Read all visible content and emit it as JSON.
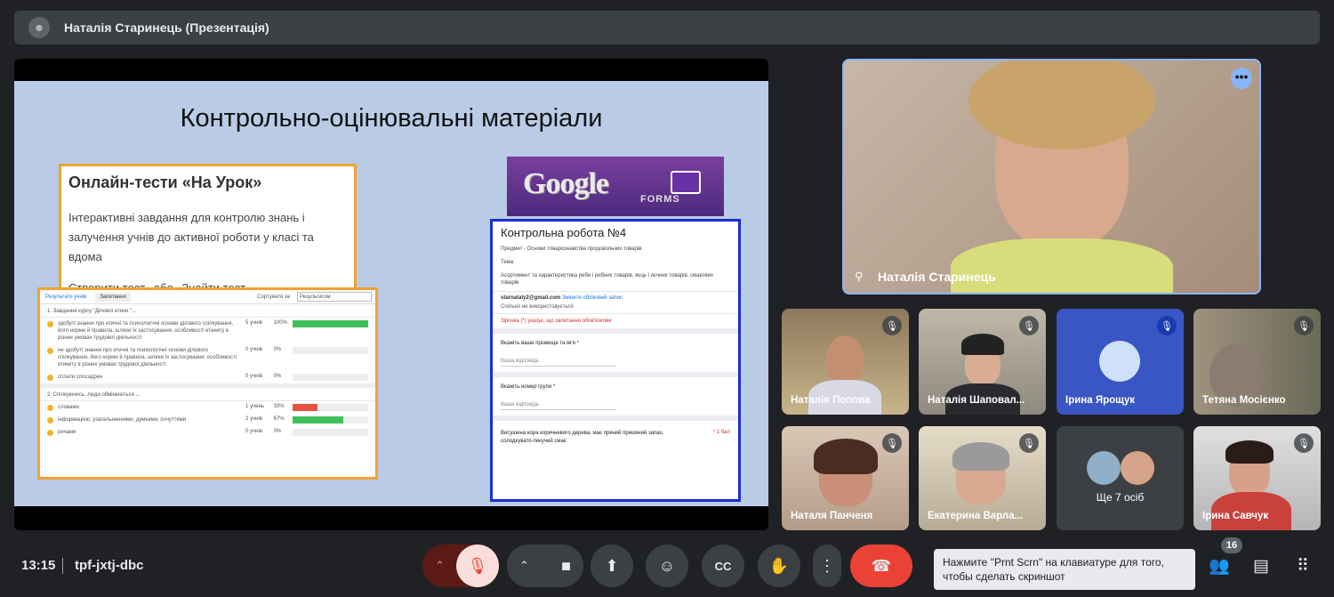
{
  "header": {
    "title": "Наталія Старинець (Презентація)",
    "avatar_icon": "presenter-avatar"
  },
  "slide": {
    "title": "Контрольно-оцінювальні матеріали",
    "card1": {
      "heading": "Онлайн-тести «На Урок»",
      "text": "Інтерактивні завдання для контролю знань і залучення учнів до активної роботи у класі та вдома",
      "link_create": "Створити тест",
      "or": "або",
      "link_find": "Знайти тест"
    },
    "card2": {
      "tab_results": "Результати учнів",
      "tab_questions": "Запитання",
      "sort_label": "Сортувати за",
      "sort_value": "Результатом",
      "q1": "1. Завдання курсу \"Ділової етики \"...",
      "q1_rows": [
        {
          "text": "здобуті знання про етичні та психологічні основи ділового спілкування, його норми й правила, шляхи їх застосування, особливості етикету в різних умовах трудової діяльності",
          "count": "5 учнів",
          "pct": "100%",
          "fill": 1.0,
          "color": "#3fbf5a"
        },
        {
          "text": "не здобуті знання про етичні та психологічні основи ділового спілкування, його норми й правила, шляхи їх застосування, особливості етикету в різних умовах трудової діяльності",
          "count": "0 учнів",
          "pct": "0%",
          "fill": 0,
          "color": "#3fbf5a"
        },
        {
          "text": "сплати слосадрен",
          "count": "0 учнів",
          "pct": "0%",
          "fill": 0,
          "color": "#3fbf5a"
        }
      ],
      "q2": "2. Спілкуючись, люди обмінюються ...",
      "q2_rows": [
        {
          "text": "словами",
          "count": "1 учень",
          "pct": "33%",
          "fill": 0.33,
          "color": "#e8533f"
        },
        {
          "text": "інформацією, узагальненнями, думками, почуттями",
          "count": "2 учнів",
          "pct": "67%",
          "fill": 0.67,
          "color": "#3fbf5a"
        },
        {
          "text": "речами",
          "count": "0 учнів",
          "pct": "0%",
          "fill": 0,
          "color": "#3fbf5a"
        }
      ]
    },
    "gforms": {
      "brand": "Google",
      "sub": "FORMS"
    },
    "card3": {
      "heading": "Контрольна робота №4",
      "subject": "Предмет - Основи товарознавства продовольчих товарів.",
      "theme_label": "Тема:",
      "theme": "Асортимент та характеристика риби і рибних товарів, яєць і яєчних товарів, смакових товарів",
      "email": "starnataly2@gmail.com",
      "switch": "Змінити обліковий запис",
      "not_shared": "Спільно не використовується",
      "required_note": "Зірочка (*) указує, що запитання обов'язкове",
      "q1": "Вкажіть ваше прізвище та ім'я *",
      "q1_answer": "Ваша відповідь",
      "q2": "Вкажіть номер групи *",
      "q2_answer": "Ваша відповідь",
      "q3": "Висушена кора коричневого дерева, має пряний приємний запах, солодкувато-пекучий смак",
      "q3_points": "* 1 бал"
    }
  },
  "main_tile": {
    "name": "Наталія Старинець",
    "more_icon": "more-options-icon"
  },
  "tiles": [
    {
      "name": "Наталія Попова"
    },
    {
      "name": "Наталія Шаповал..."
    },
    {
      "name": "Ірина Ярощук"
    },
    {
      "name": "Тетяна Мосієнко"
    },
    {
      "name": "Наталя Панченя"
    },
    {
      "name": "Екатерина Варла..."
    },
    {
      "name": "Ще 7 осіб"
    },
    {
      "name": "Ірина Савчук"
    }
  ],
  "bottom": {
    "time": "13:15",
    "meeting_code": "tpf-jxtj-dbc",
    "tooltip": "Нажмите \"Prnt Scrn\" на клавиатуре для того, чтобы сделать скриншот",
    "participants_count": "16"
  }
}
